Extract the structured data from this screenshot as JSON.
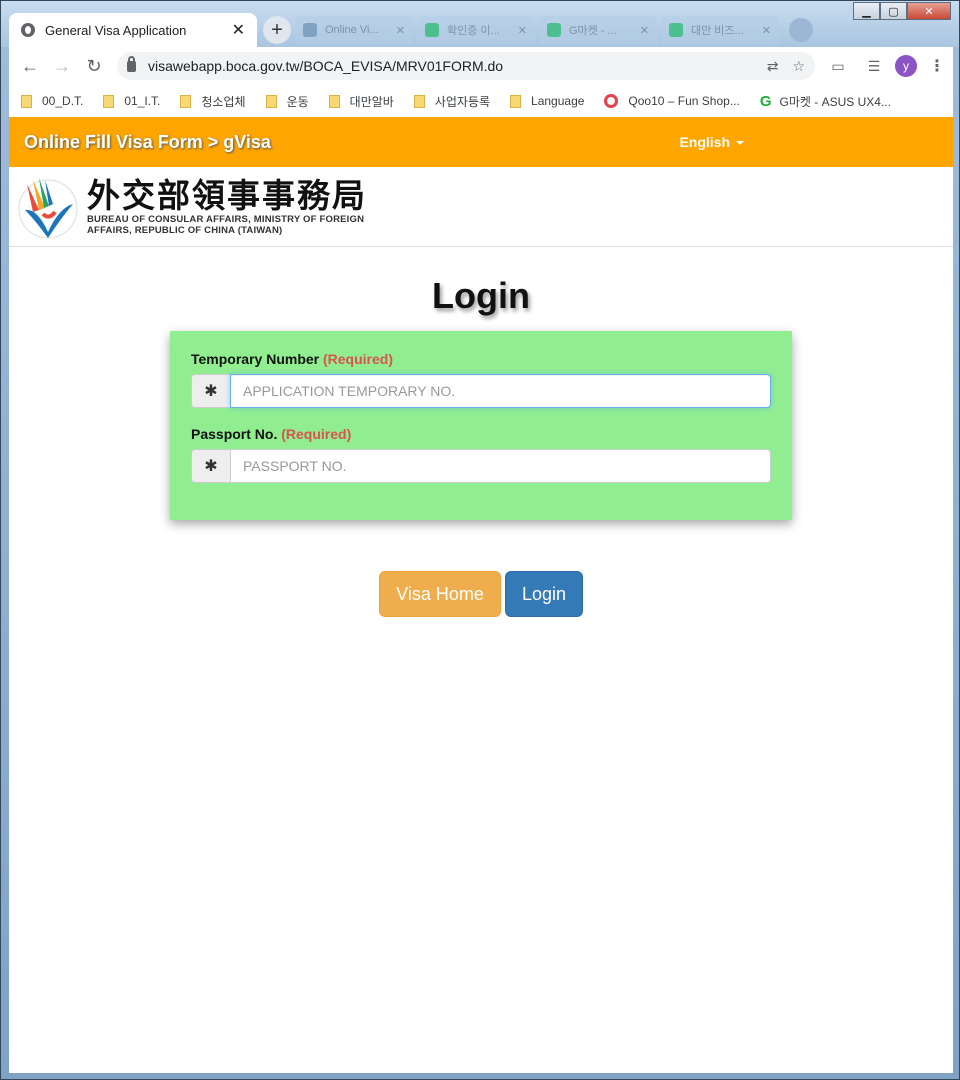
{
  "browser": {
    "active_tab": {
      "title": "General Visa Application"
    },
    "background_tabs": [
      {
        "title": "Online Vi..."
      },
      {
        "title": "확인증 이..."
      },
      {
        "title": "G마켓 - ..."
      },
      {
        "title": "대만 비즈..."
      }
    ],
    "url": "visawebapp.boca.gov.tw/BOCA_EVISA/MRV01FORM.do",
    "profile_initial": "y",
    "bookmarks": [
      {
        "label": "00_D.T.",
        "icon": "folder-icon"
      },
      {
        "label": "01_I.T.",
        "icon": "folder-icon"
      },
      {
        "label": "청소업체",
        "icon": "folder-icon"
      },
      {
        "label": "운동",
        "icon": "folder-icon"
      },
      {
        "label": "대만알바",
        "icon": "folder-icon"
      },
      {
        "label": "사업자등록",
        "icon": "folder-icon"
      },
      {
        "label": "Language",
        "icon": "folder-icon"
      },
      {
        "label": "Qoo10 – Fun Shop...",
        "icon": "qoo10-icon"
      },
      {
        "label": "G마켓 - ASUS UX4...",
        "icon": "gmarket-icon"
      }
    ]
  },
  "header": {
    "brand": "Online Fill Visa Form > gVisa",
    "language": "English",
    "accent_color": "#ffa500"
  },
  "logo": {
    "chinese": "外交部領事事務局",
    "english_line1": "BUREAU OF CONSULAR AFFAIRS, MINISTRY OF FOREIGN",
    "english_line2": "AFFAIRS, REPUBLIC OF CHINA (TAIWAN)"
  },
  "form": {
    "title": "Login",
    "panel_color": "#90ee90",
    "temp_number": {
      "label": "Temporary Number",
      "required": "(Required)",
      "addon": "✱",
      "placeholder": "APPLICATION TEMPORARY NO.",
      "value": ""
    },
    "passport": {
      "label": "Passport No.",
      "required": "(Required)",
      "addon": "✱",
      "placeholder": "PASSPORT NO.",
      "value": ""
    }
  },
  "buttons": {
    "visa_home": "Visa Home",
    "login": "Login"
  }
}
